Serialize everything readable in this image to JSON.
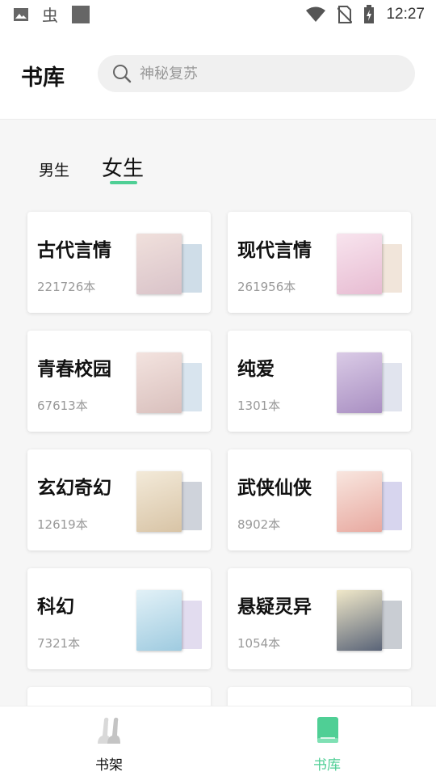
{
  "status_bar": {
    "time": "12:27"
  },
  "header": {
    "title": "书库"
  },
  "search": {
    "placeholder": "神秘复苏"
  },
  "tabs": [
    {
      "label": "男生"
    },
    {
      "label": "女生"
    }
  ],
  "categories": [
    {
      "name": "古代言情",
      "count": "221726本",
      "cover_color": "#e8d6d2",
      "cover_accent": "#cfdde8"
    },
    {
      "name": "现代言情",
      "count": "261956本",
      "cover_color": "#f3d7e4",
      "cover_accent": "#f1e5da"
    },
    {
      "name": "青春校园",
      "count": "67613本",
      "cover_color": "#ecd9d7",
      "cover_accent": "#d8e4ee"
    },
    {
      "name": "纯爱",
      "count": "1301本",
      "cover_color": "#c9b7d8",
      "cover_accent": "#e1e4ee"
    },
    {
      "name": "玄幻奇幻",
      "count": "12619本",
      "cover_color": "#eadfce",
      "cover_accent": "#cfd3db"
    },
    {
      "name": "武侠仙侠",
      "count": "8902本",
      "cover_color": "#f2dcd6",
      "cover_accent": "#d7d5ee"
    },
    {
      "name": "科幻",
      "count": "7321本",
      "cover_color": "#cfe6f0",
      "cover_accent": "#e2dcef"
    },
    {
      "name": "悬疑灵异",
      "count": "1054本",
      "cover_color": "#e9dfbd",
      "cover_accent": "#c9cdd3"
    }
  ],
  "bottom_nav": [
    {
      "label": "书架"
    },
    {
      "label": "书库"
    }
  ],
  "colors": {
    "accent": "#4fcf95"
  }
}
